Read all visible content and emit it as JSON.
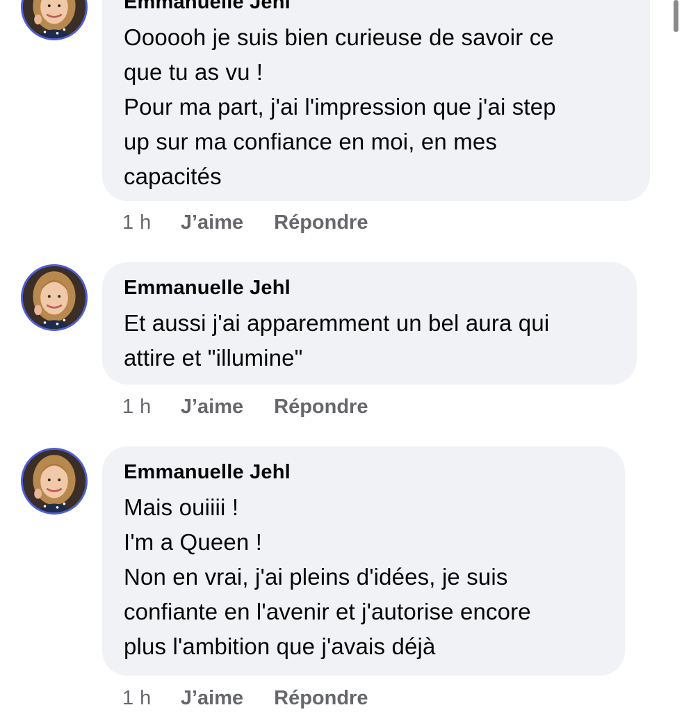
{
  "comments": [
    {
      "author": "Emmanuelle Jehl",
      "text": "Oooooh je suis bien curieuse de savoir ce\nque tu as vu !\nPour ma part, j'ai l'impression que j'ai step\nup sur ma confiance en moi, en mes\ncapacités",
      "time": "1 h",
      "like_label": "J’aime",
      "reply_label": "Répondre"
    },
    {
      "author": "Emmanuelle Jehl",
      "text": "Et aussi j'ai apparemment un bel aura qui\nattire et \"illumine\"",
      "time": "1 h",
      "like_label": "J’aime",
      "reply_label": "Répondre"
    },
    {
      "author": "Emmanuelle Jehl",
      "text": "Mais ouiiii !\nI'm a Queen !\nNon en vrai, j'ai pleins d'idées, je suis\nconfiante en l'avenir et j'autorise encore\nplus l'ambition que j'avais déjà",
      "time": "1 h",
      "like_label": "J’aime",
      "reply_label": "Répondre"
    }
  ],
  "colors": {
    "bubble_bg": "#f0f2f5",
    "avatar_ring": "#4f5fd6",
    "meta_text": "#65676b",
    "body_text": "#050505"
  },
  "icons": [
    "profile-photo"
  ]
}
